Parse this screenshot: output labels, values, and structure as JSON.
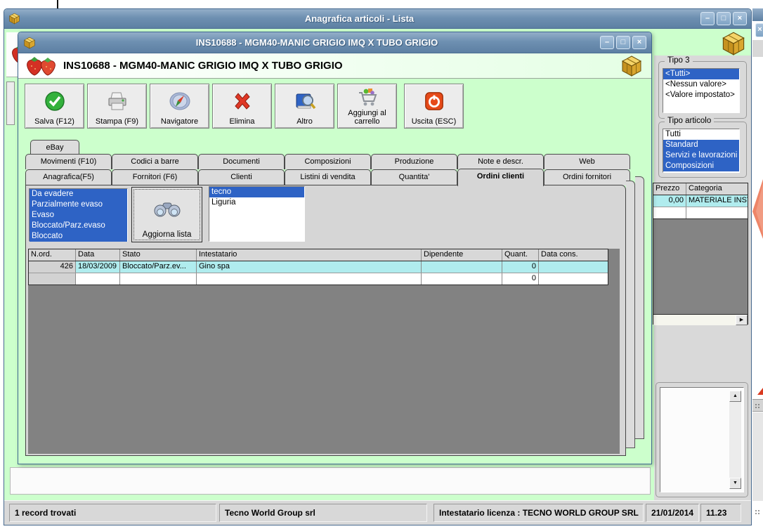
{
  "colors": {
    "selection_blue": "#2e63c5",
    "highlight_row_cyan": "#b0ecee",
    "titlebar_blue": "#6e90b1",
    "content_green": "#ccffcc",
    "panel_gray": "#d6d6d6",
    "dark_area_gray": "#828282",
    "exit_red": "#e64a19",
    "check_green": "#33b13c"
  },
  "outer_window": {
    "title": "Anagrafica articoli  - Lista",
    "controls": {
      "minimize": "–",
      "maximize": "□",
      "close": "×"
    }
  },
  "inner_window": {
    "title": "INS10688 - MGM40-MANIC GRIGIO IMQ X TUBO GRIGIO",
    "header_title": "INS10688 - MGM40-MANIC GRIGIO IMQ X TUBO GRIGIO",
    "controls": {
      "minimize": "–",
      "maximize": "□",
      "close": "×"
    },
    "toolbar": {
      "save": "Salva (F12)",
      "print": "Stampa (F9)",
      "navigator": "Navigatore",
      "delete": "Elimina",
      "other": "Altro",
      "add_to_cart": "Aggiungi al carrello",
      "exit": "Uscita (ESC)"
    },
    "tabs_row_top": [
      "eBay"
    ],
    "tabs_row_mid": [
      "Movimenti (F10)",
      "Codici a barre",
      "Documenti",
      "Composizioni",
      "Produzione",
      "Note e descr.",
      "Web"
    ],
    "tabs_row_bottom": [
      "Anagrafica(F5)",
      "Fornitori (F6)",
      "Clienti",
      "Listini di vendita",
      "Quantita'",
      "Ordini clienti",
      "Ordini fornitori"
    ],
    "active_tab": "Ordini clienti",
    "filter": {
      "status_options": [
        {
          "label": "Da evadere",
          "selected": true
        },
        {
          "label": "Parzialmente evaso",
          "selected": true
        },
        {
          "label": "Evaso",
          "selected": true
        },
        {
          "label": "Bloccato/Parz.evaso",
          "selected": true
        },
        {
          "label": "Bloccato",
          "selected": true
        }
      ],
      "refresh_label": "Aggiorna lista",
      "customer_options": [
        {
          "label": "tecno",
          "selected": true
        },
        {
          "label": "Liguria",
          "selected": false
        }
      ]
    },
    "orders": {
      "columns": [
        "N.ord.",
        "Data",
        "Stato",
        "Intestatario",
        "Dipendente",
        "Quant.",
        "Data cons."
      ],
      "rows": [
        [
          "426",
          "18/03/2009",
          "Bloccato/Parz.ev...",
          "Gino spa",
          "",
          "0",
          ""
        ],
        [
          "",
          "",
          "",
          "",
          "",
          "0",
          ""
        ]
      ]
    }
  },
  "right_panel": {
    "tipo3": {
      "label": "Tipo 3",
      "options": [
        {
          "label": "<Tutti>",
          "selected": true
        },
        {
          "label": "<Nessun valore>",
          "selected": false
        },
        {
          "label": "<Valore impostato>",
          "selected": false
        }
      ]
    },
    "tipo_articolo": {
      "label": "Tipo articolo",
      "options": [
        {
          "label": "Tutti",
          "selected": false
        },
        {
          "label": "Standard",
          "selected": true
        },
        {
          "label": "Servizi e lavorazioni",
          "selected": true
        },
        {
          "label": "Composizioni",
          "selected": true
        }
      ]
    },
    "prices": {
      "columns": [
        "Prezzo",
        "Categoria"
      ],
      "rows": [
        [
          "0,00",
          "MATERIALE INST..."
        ],
        [
          "",
          ""
        ]
      ]
    }
  },
  "status_bar": {
    "records": "1 record trovati",
    "company": "Tecno World Group srl",
    "license": "Intestatario licenza : TECNO WORLD GROUP SRL",
    "date": "21/01/2014",
    "time": "11.23"
  }
}
